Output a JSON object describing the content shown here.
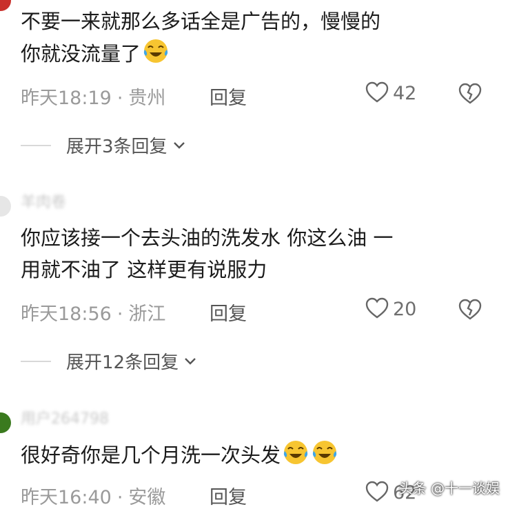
{
  "comments": [
    {
      "content_lines": [
        "不要一来就那么多话全是广告的，慢慢的",
        "你就没流量了"
      ],
      "emoji_count": 1,
      "date": "昨天18:19",
      "location": "贵州",
      "reply_label": "回复",
      "likes": "42",
      "expand_label": "展开3条回复"
    },
    {
      "username": "羊肉卷",
      "content_lines": [
        "你应该接一个去头油的洗发水  你这么油 一",
        "用就不油了 这样更有说服力"
      ],
      "emoji_count": 0,
      "date": "昨天18:56",
      "location": "浙江",
      "reply_label": "回复",
      "likes": "20",
      "expand_label": "展开12条回复"
    },
    {
      "username": "用户264798",
      "content_lines": [
        "很好奇你是几个月洗一次头发"
      ],
      "emoji_count": 2,
      "date": "昨天16:40",
      "location": "安徽",
      "reply_label": "回复",
      "likes": "62"
    }
  ],
  "separator": "·",
  "watermark": "头条 @十一谈娱",
  "icons": {
    "emoji": "laughing-crying-emoji",
    "like": "heart-outline-icon",
    "dislike": "broken-heart-icon",
    "expand": "chevron-down-icon"
  },
  "colors": {
    "meta": "#9a9a9a",
    "text": "#1b1b1b",
    "emoji_face": "#f7c531",
    "tears": "#3fa6e8"
  }
}
